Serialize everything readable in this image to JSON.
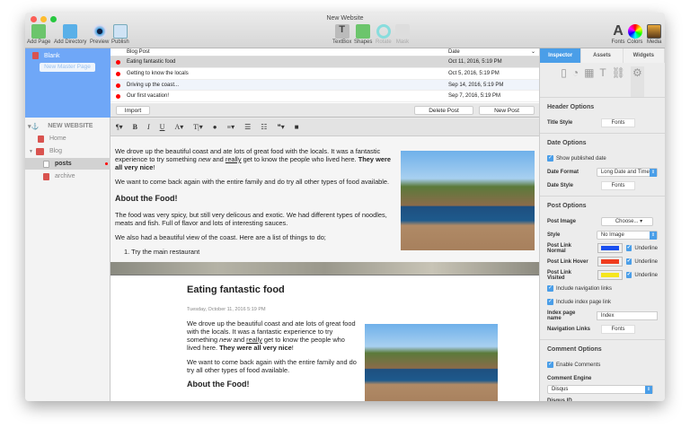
{
  "window": {
    "title": "New Website"
  },
  "toolbar": {
    "left": [
      "Add Page",
      "Add Directory",
      "Preview",
      "Publish"
    ],
    "center": [
      "TextBox",
      "Shapes",
      "Rotate",
      "Mask"
    ],
    "right": [
      "Fonts",
      "Colors",
      "Media"
    ]
  },
  "sidebar": {
    "master_item": "Blank",
    "new_master_button": "New Master Page",
    "site": "NEW WEBSITE",
    "items": [
      "Home",
      "Blog",
      "posts",
      "archive"
    ]
  },
  "posts": {
    "col_title": "Blog Post",
    "col_date": "Date",
    "rows": [
      {
        "title": "Eating fantastic food",
        "date": "Oct 11, 2016, 5:19 PM"
      },
      {
        "title": "Getting to know the locals",
        "date": "Oct 5, 2016, 5:19 PM"
      },
      {
        "title": "Driving up the coast...",
        "date": "Sep 14, 2016, 5:19 PM"
      },
      {
        "title": "Our first vacation!",
        "date": "Sep 7, 2016, 5:19 PM"
      }
    ],
    "import": "Import",
    "delete": "Delete Post",
    "new": "New Post"
  },
  "editor": {
    "p1a": "We drove up the beautiful coast and ate lots of great food with the locals. It was a fantastic experience to try something ",
    "em": "new",
    "p1b": " and ",
    "u": "really",
    "p1c": " get to know the people who lived here. ",
    "strong": "They were all very nice",
    "p1d": "!",
    "p2": "We want to come back again with the entire family and do try all other types of food available.",
    "h": "About the Food!",
    "p3": "The food was very spicy, but still very delicous and exotic. We had different types of noodles, meats and fish. Full of flavor and lots of interesting sauces.",
    "p4": "We also had a beautiful view of the coast. Here are a list of things to do;",
    "li1": "1.   Try the main restaurant"
  },
  "preview": {
    "title": "Eating fantastic food",
    "date": "Tuesday, October 11, 2016 5:19 PM"
  },
  "inspector": {
    "tabs": [
      "Inspector",
      "Assets",
      "Widgets"
    ],
    "header_options": "Header Options",
    "title_style": "Title Style",
    "fonts": "Fonts",
    "date_options": "Date Options",
    "show_date": "Show published date",
    "date_format": "Date Format",
    "date_format_value": "Long Date and Time",
    "date_style": "Date Style",
    "post_options": "Post Options",
    "post_image": "Post Image",
    "choose": "Choose...",
    "style": "Style",
    "style_value": "No Image",
    "link_normal": "Post Link Normal",
    "link_hover": "Post Link Hover",
    "link_visited": "Post Link Visited",
    "underline": "Underline",
    "colors": {
      "normal": "#1a4ff0",
      "hover": "#f03c1e",
      "visited": "#f5e61e"
    },
    "include_nav": "Include navigation links",
    "include_index": "Include index page link",
    "index_name": "Index page name",
    "index_value": "Index",
    "nav_links": "Navigation Links",
    "comment_options": "Comment Options",
    "enable_comments": "Enable Comments",
    "comment_engine": "Comment Engine",
    "engine_value": "Disqus",
    "disqus_id": "Disqus ID"
  }
}
